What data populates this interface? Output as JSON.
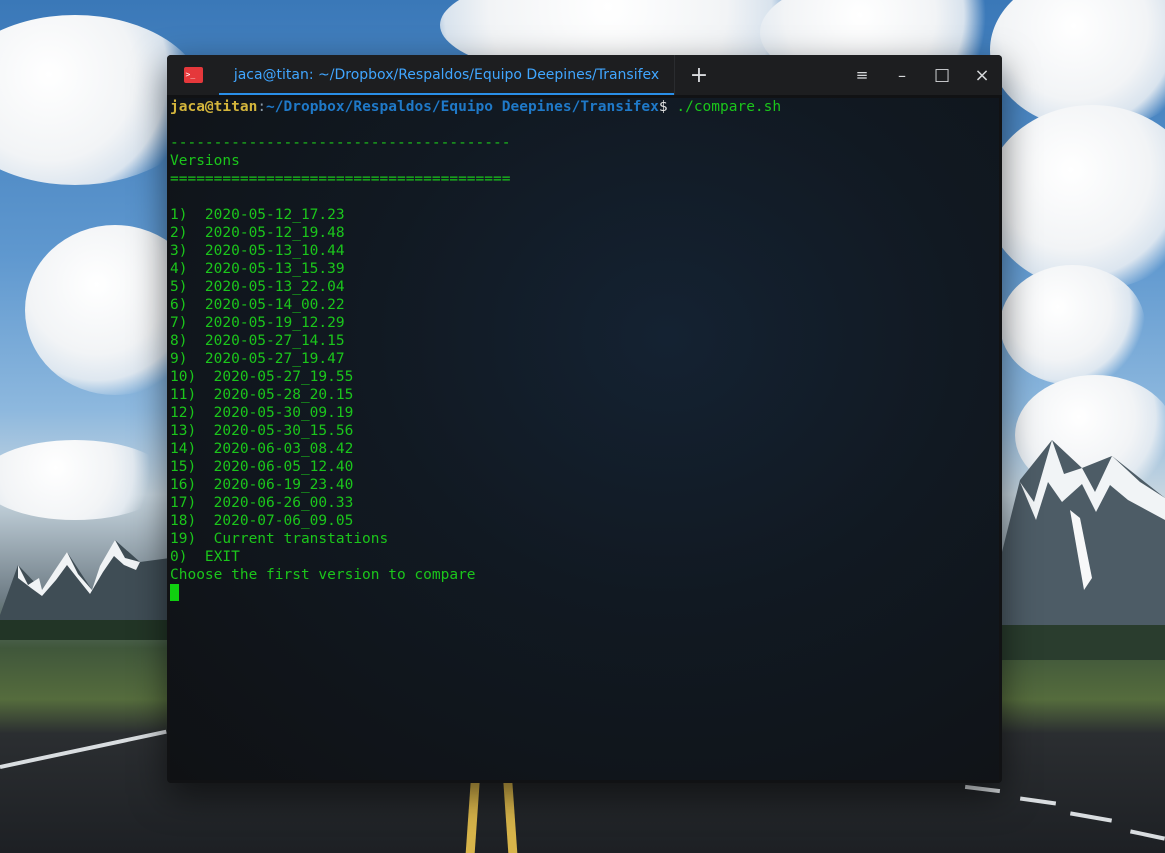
{
  "window": {
    "tab_title": "jaca@titan: ~/Dropbox/Respaldos/Equipo Deepines/Transifex",
    "new_tab_icon": "+",
    "menu_icon": "≡",
    "minimize_icon": "–",
    "maximize_icon": "□",
    "close_icon": "×",
    "accent_color": "#2a8fe8",
    "tab_text_color": "#40a6ff"
  },
  "terminal": {
    "prompt": {
      "user": "jaca@titan",
      "path": "~/Dropbox/Respaldos/Equipo Deepines/Transifex",
      "symbol": "$",
      "command": "./compare.sh"
    },
    "lines": {
      "separator_top": "---------------------------------------",
      "heading": "Versions",
      "separator_bottom": "======================================="
    },
    "versions": [
      "1)  2020-05-12_17.23",
      "2)  2020-05-12_19.48",
      "3)  2020-05-13_10.44",
      "4)  2020-05-13_15.39",
      "5)  2020-05-13_22.04",
      "6)  2020-05-14_00.22",
      "7)  2020-05-19_12.29",
      "8)  2020-05-27_14.15",
      "9)  2020-05-27_19.47",
      "10)  2020-05-27_19.55",
      "11)  2020-05-28_20.15",
      "12)  2020-05-30_09.19",
      "13)  2020-05-30_15.56",
      "14)  2020-06-03_08.42",
      "15)  2020-06-05_12.40",
      "16)  2020-06-19_23.40",
      "17)  2020-06-26_00.33",
      "18)  2020-07-06_09.05",
      "19)  Current transtations",
      "0)  EXIT"
    ],
    "question": "Choose the first version to compare",
    "colors": {
      "output": "#1bc61b",
      "user": "#d3b53c",
      "path": "#1f79c8"
    }
  }
}
